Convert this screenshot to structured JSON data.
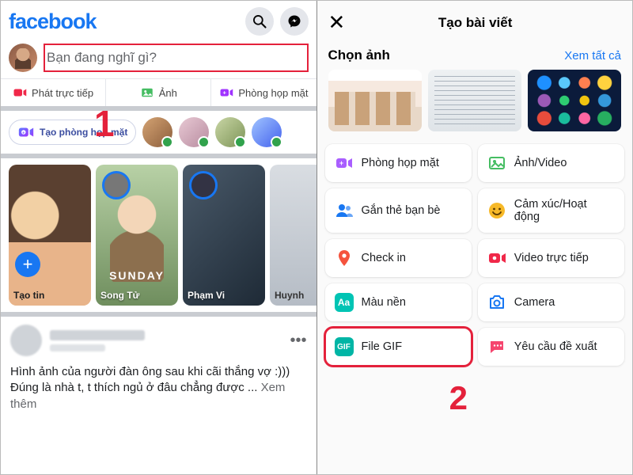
{
  "left": {
    "logo": "facebook",
    "composer_placeholder": "Bạn đang nghĩ gì?",
    "actions": {
      "live": "Phát trực tiếp",
      "photo": "Ảnh",
      "room": "Phòng họp mặt"
    },
    "rooms_button": "Tạo phòng họp mặt",
    "stories": [
      "Tạo tin",
      "Song Tử",
      "Phạm Vi",
      "Huynh"
    ],
    "story_sunday": "SUNDAY",
    "post_text": "Hình ảnh của người đàn ông sau khi cãi thắng vợ :))) Đúng là nhà t, t thích ngủ ở đâu chẳng được ... ",
    "post_more": "Xem thêm"
  },
  "right": {
    "title": "Tạo bài viết",
    "pick_label": "Chọn ảnh",
    "see_all": "Xem tất cả",
    "options": [
      "Phòng họp mặt",
      "Ảnh/Video",
      "Gắn thẻ bạn bè",
      "Cảm xúc/Hoạt động",
      "Check in",
      "Video trực tiếp",
      "Màu nền",
      "Camera",
      "File GIF",
      "Yêu cầu đề xuất"
    ],
    "gif_badge": "GIF",
    "aa_badge": "Aa"
  },
  "annotations": {
    "one": "1",
    "two": "2"
  }
}
